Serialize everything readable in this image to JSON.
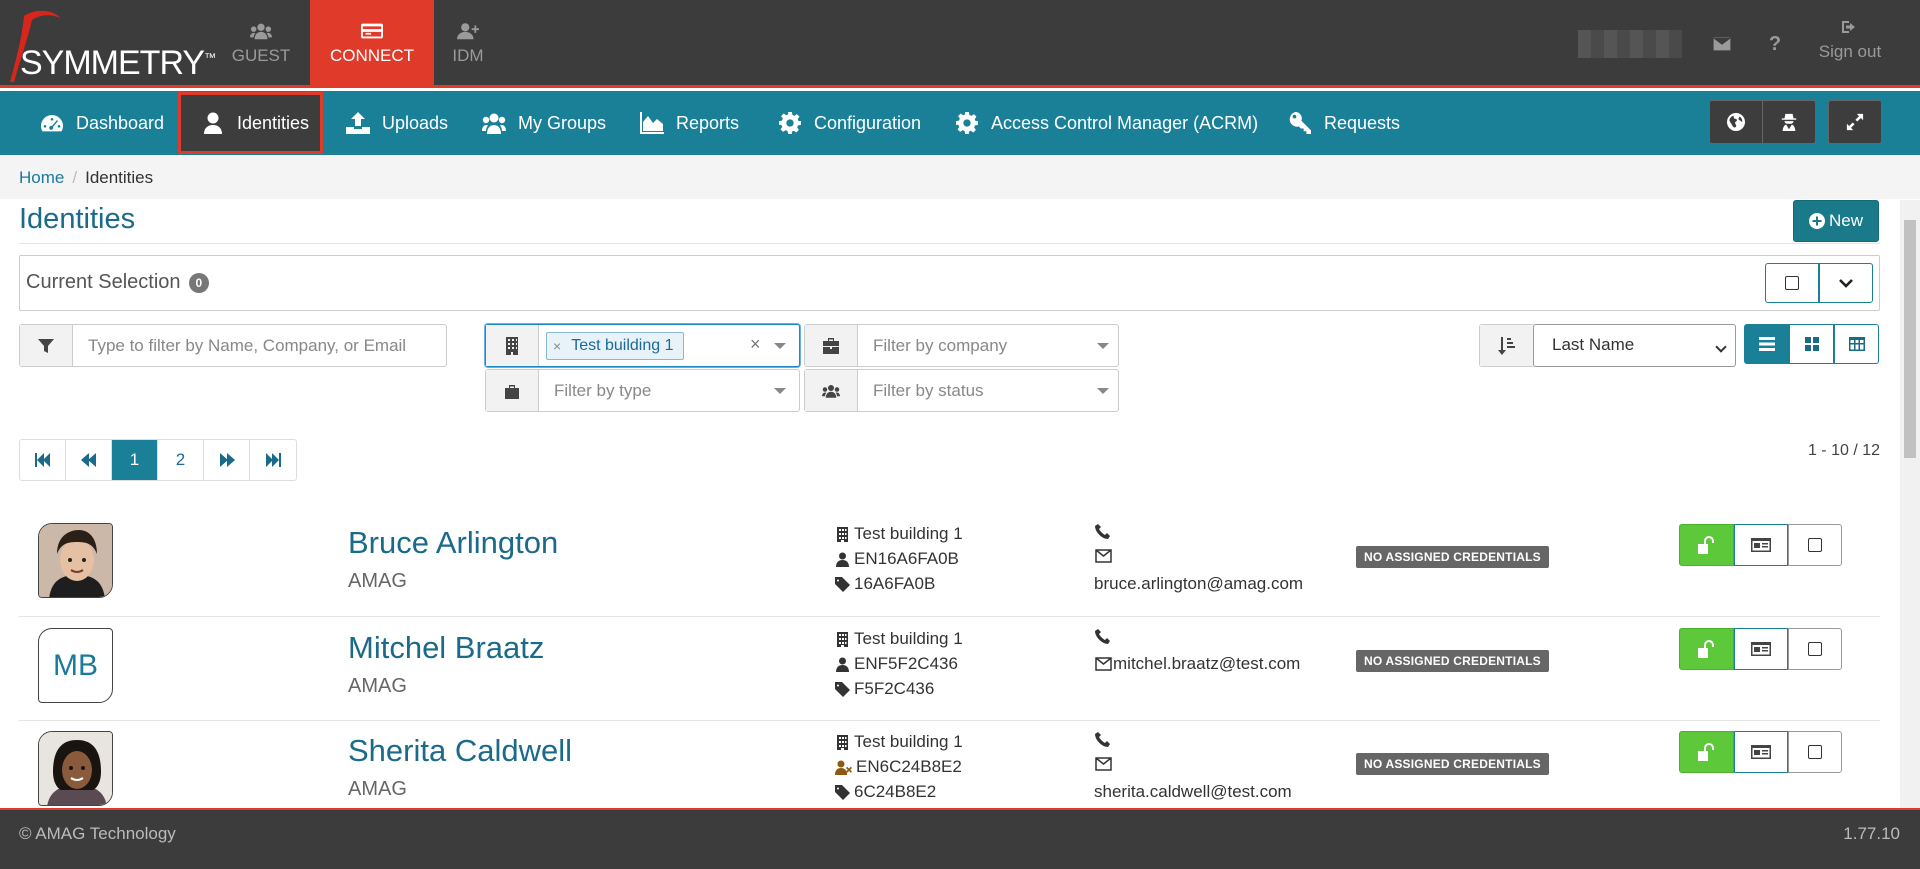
{
  "brand": {
    "name": "SYMMETRY",
    "tm": "™"
  },
  "apps": [
    {
      "label": "GUEST",
      "icon": "users-icon"
    },
    {
      "label": "CONNECT",
      "icon": "card-icon"
    },
    {
      "label": "IDM",
      "icon": "user-plus-icon"
    }
  ],
  "header": {
    "sign_out": "Sign out"
  },
  "nav": {
    "dashboard": "Dashboard",
    "identities": "Identities",
    "uploads": "Uploads",
    "my_groups": "My Groups",
    "reports": "Reports",
    "configuration": "Configuration",
    "acrm": "Access Control Manager (ACRM)",
    "requests": "Requests"
  },
  "breadcrumb": {
    "home": "Home",
    "current": "Identities"
  },
  "page": {
    "title": "Identities",
    "new_button": "New"
  },
  "selection": {
    "label": "Current Selection",
    "count": "0"
  },
  "filters": {
    "name_placeholder": "Type to filter by Name, Company, or Email",
    "building_tag": "Test building 1",
    "company_placeholder": "Filter by company",
    "type_placeholder": "Filter by type",
    "status_placeholder": "Filter by status",
    "sort_value": "Last Name"
  },
  "pagination": {
    "pages": [
      "1",
      "2"
    ],
    "current": "1",
    "range": "1 - 10 / 12"
  },
  "identities": [
    {
      "name": "Bruce Arlington",
      "company": "AMAG",
      "building": "Test building 1",
      "id": "EN16A6FA0B",
      "tag": "16A6FA0B",
      "phone": "",
      "email": "bruce.arlington@amag.com",
      "credentials": "NO ASSIGNED CREDENTIALS",
      "avatar": "photo"
    },
    {
      "name": "Mitchel Braatz",
      "company": "AMAG",
      "building": "Test building 1",
      "id": "ENF5F2C436",
      "tag": "F5F2C436",
      "phone": "",
      "email": "mitchel.braatz@test.com",
      "credentials": "NO ASSIGNED CREDENTIALS",
      "avatar": "MB"
    },
    {
      "name": "Sherita Caldwell",
      "company": "AMAG",
      "building": "Test building 1",
      "id": "EN6C24B8E2",
      "tag": "6C24B8E2",
      "phone": "",
      "email": "sherita.caldwell@test.com",
      "credentials": "NO ASSIGNED CREDENTIALS",
      "avatar": "photo"
    }
  ],
  "footer": {
    "copyright": "© AMAG Technology",
    "version": "1.77.10"
  },
  "colors": {
    "brand_red": "#e03a2a",
    "nav_teal": "#1a8098",
    "unlock_green": "#5cc83a",
    "topbar": "#3c3c3c"
  }
}
